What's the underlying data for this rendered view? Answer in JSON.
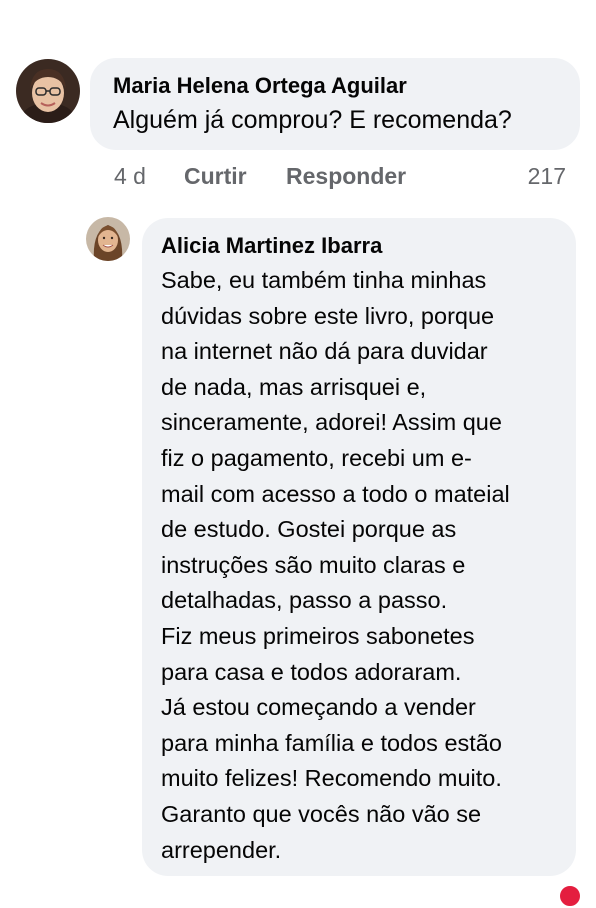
{
  "comments": [
    {
      "author": "Maria Helena Ortega Aguilar",
      "text": "Alguém já comprou? E recomenda?",
      "age": "4 d",
      "like_label": "Curtir",
      "reply_label": "Responder",
      "reaction_count": "217",
      "avatar_icon": "woman-with-glasses-avatar"
    },
    {
      "author": "Alicia Martinez Ibarra",
      "text": "Sabe, eu também tinha minhas\ndúvidas sobre este livro, porque\nna internet não dá para duvidar\nde nada, mas arrisquei e,\nsinceramente, adorei! Assim que\nfiz o pagamento, recebi um e-\nmail com acesso a todo o mateial\nde estudo. Gostei porque as\ninstruções são muito claras e\ndetalhadas, passo a passo.\nFiz meus primeiros sabonetes\npara casa e todos adoraram.\nJá estou começando a vender\npara minha família e todos estão\nmuito felizes! Recomendo muito.\nGaranto que vocês não vão se\narrepender.",
      "avatar_icon": "smiling-woman-avatar",
      "reaction_icon": "heart-reaction-icon",
      "reaction_color": "#e41e3f"
    }
  ]
}
